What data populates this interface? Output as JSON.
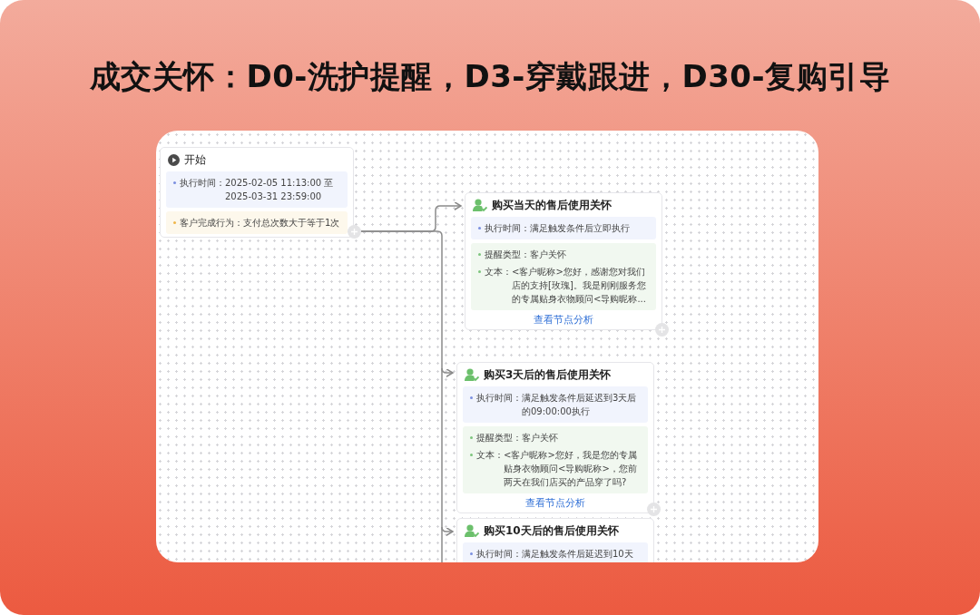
{
  "title": "成交关怀：D0-洗护提醒，D3-穿戴跟进，D30-复购引导",
  "nodes": [
    {
      "kind": "start",
      "title": "开始",
      "blocks": [
        {
          "kind": "timing",
          "items": [
            {
              "label": "执行时间：",
              "value": "2025-02-05 11:13:00 至 2025-03-31 23:59:00"
            }
          ]
        },
        {
          "kind": "condition",
          "items": [
            {
              "label": "客户完成行为：",
              "value": "支付总次数大于等于1次"
            }
          ]
        }
      ]
    },
    {
      "kind": "step",
      "title": "购买当天的售后使用关怀",
      "blocks": [
        {
          "kind": "timing",
          "items": [
            {
              "label": "执行时间：",
              "value": "满足触发条件后立即执行"
            }
          ]
        },
        {
          "kind": "message",
          "items": [
            {
              "label": "提醒类型：",
              "value": "客户关怀"
            },
            {
              "label": "文本：",
              "value": "<客户昵称>您好，感谢您对我们店的支持[玫瑰]。我是刚刚服务您的专属贴身衣物顾问<导购昵称..."
            }
          ]
        }
      ],
      "link": "查看节点分析"
    },
    {
      "kind": "step",
      "title": "购买3天后的售后使用关怀",
      "blocks": [
        {
          "kind": "timing",
          "items": [
            {
              "label": "执行时间：",
              "value": "满足触发条件后延迟到3天后的09:00:00执行"
            }
          ]
        },
        {
          "kind": "message",
          "items": [
            {
              "label": "提醒类型：",
              "value": "客户关怀"
            },
            {
              "label": "文本：",
              "value": "<客户昵称>您好，我是您的专属贴身衣物顾问<导购昵称>，您前两天在我们店买的产品穿了吗?"
            }
          ]
        }
      ],
      "link": "查看节点分析"
    },
    {
      "kind": "step",
      "title": "购买10天后的售后使用关怀",
      "blocks": [
        {
          "kind": "timing",
          "items": [
            {
              "label": "执行时间：",
              "value": "满足触发条件后延迟到10天"
            }
          ]
        }
      ]
    }
  ]
}
